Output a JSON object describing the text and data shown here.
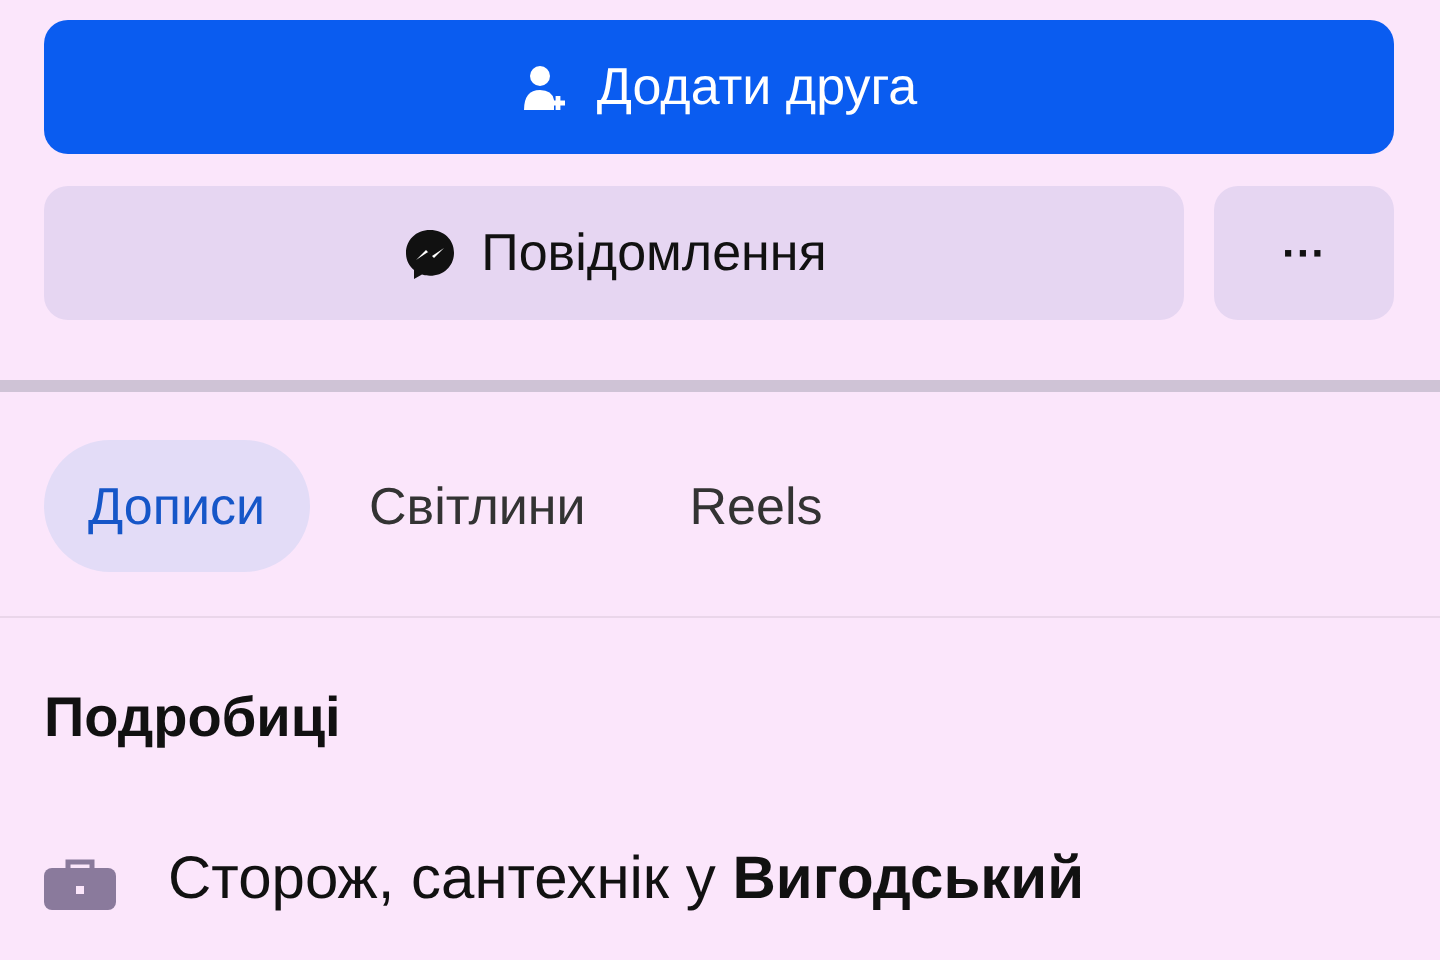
{
  "actions": {
    "primary": {
      "label": "Додати друга"
    },
    "message": {
      "label": "Повідомлення"
    },
    "more": {
      "label": "···"
    }
  },
  "tabs": [
    {
      "label": "Дописи",
      "selected": true
    },
    {
      "label": "Світлини",
      "selected": false
    },
    {
      "label": "Reels",
      "selected": false
    }
  ],
  "details": {
    "title": "Подробиці",
    "items": [
      {
        "kind": "work",
        "text": "Сторож, сантехнік у **Вигодський**"
      }
    ]
  }
}
